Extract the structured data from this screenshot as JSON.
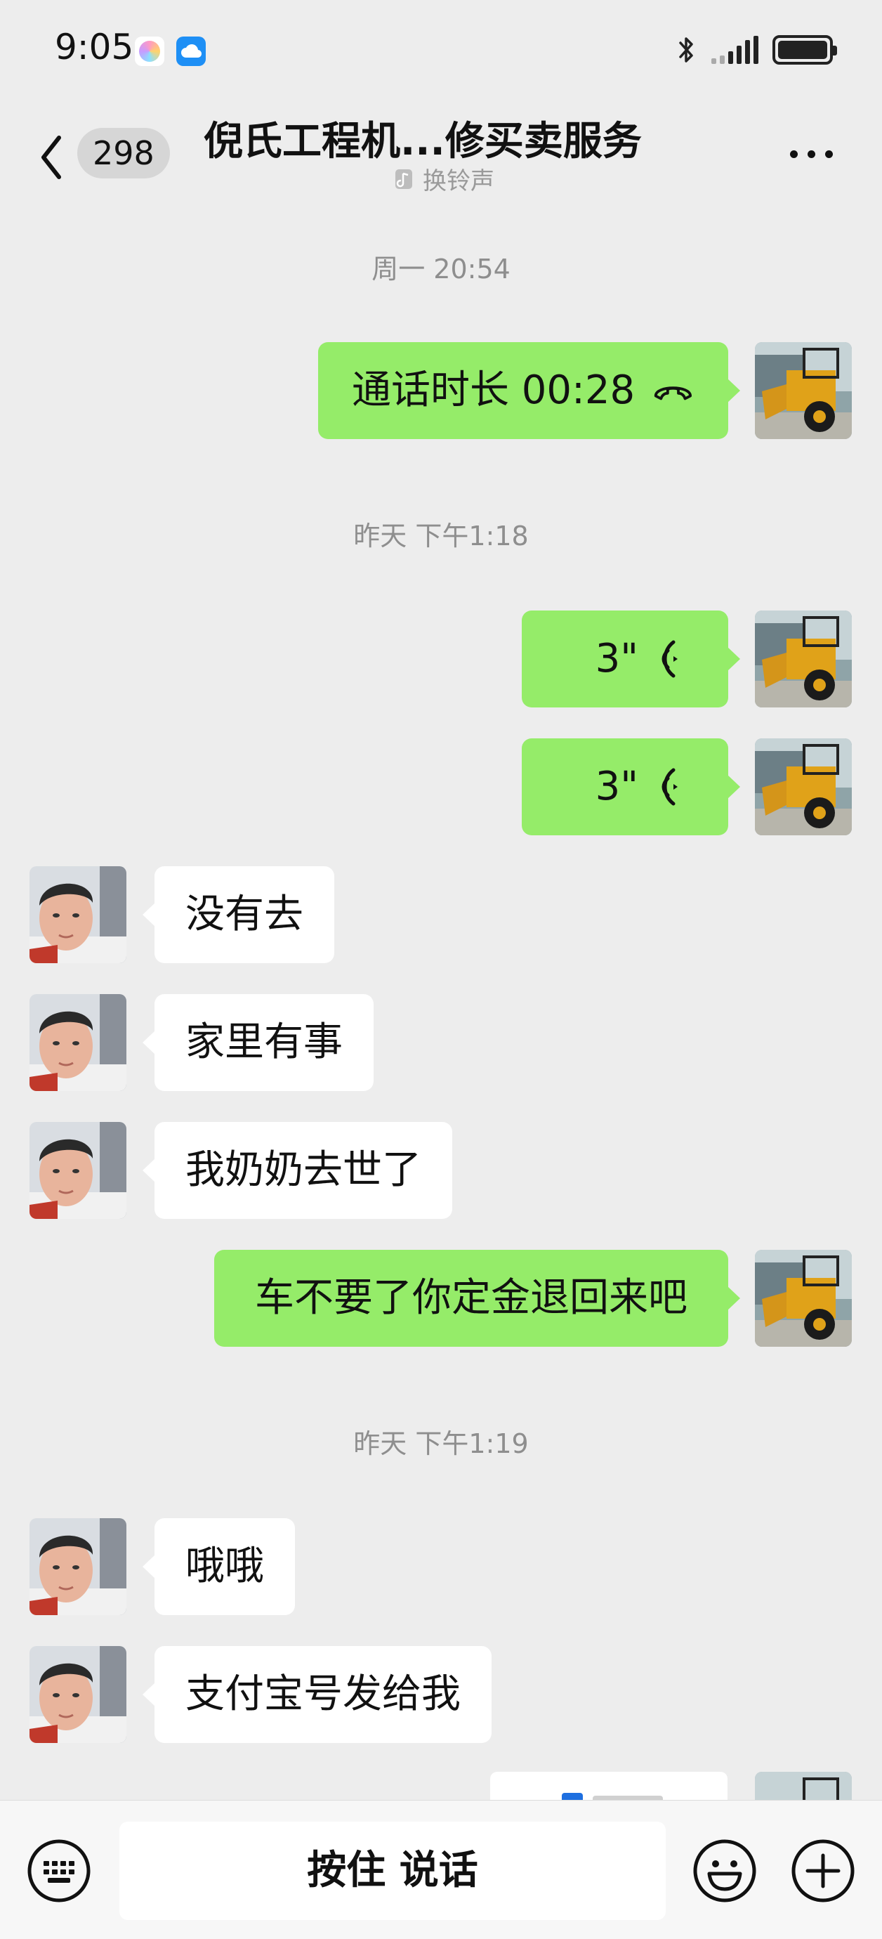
{
  "status_bar": {
    "time": "9:05",
    "app_icons": [
      "photos-app-icon",
      "cloud-app-icon"
    ],
    "right_icons": [
      "bluetooth-icon",
      "signal-icon",
      "battery-icon"
    ]
  },
  "header": {
    "back_icon": "chevron-left-icon",
    "unread_count": "298",
    "title": "倪氏工程机...修买卖服务",
    "ringtone_label": "换铃声",
    "more_icon": "more-dots-icon"
  },
  "messages": {
    "ts1": "周一 20:54",
    "call": {
      "label": "通话时长 00:28",
      "icon": "phone-hangup-icon"
    },
    "ts2": "昨天 下午1:18",
    "voice1": {
      "duration": "3\"",
      "icon": "voice-wave-icon"
    },
    "voice2": {
      "duration": "3\"",
      "icon": "voice-wave-icon"
    },
    "other1": "没有去",
    "other2": "家里有事",
    "other3": "我奶奶去世了",
    "me1": "车不要了你定金退回来吧",
    "ts3": "昨天 下午1:19",
    "other4": "哦哦",
    "other5": "支付宝号发给我"
  },
  "input_bar": {
    "hold_to_talk": "按住 说话",
    "left_icon": "keyboard-icon",
    "emoji_icon": "emoji-icon",
    "plus_icon": "plus-icon"
  },
  "colors": {
    "background": "#ededed",
    "my_bubble": "#95ec69",
    "other_bubble": "#ffffff",
    "timestamp": "#8e8e8e"
  }
}
